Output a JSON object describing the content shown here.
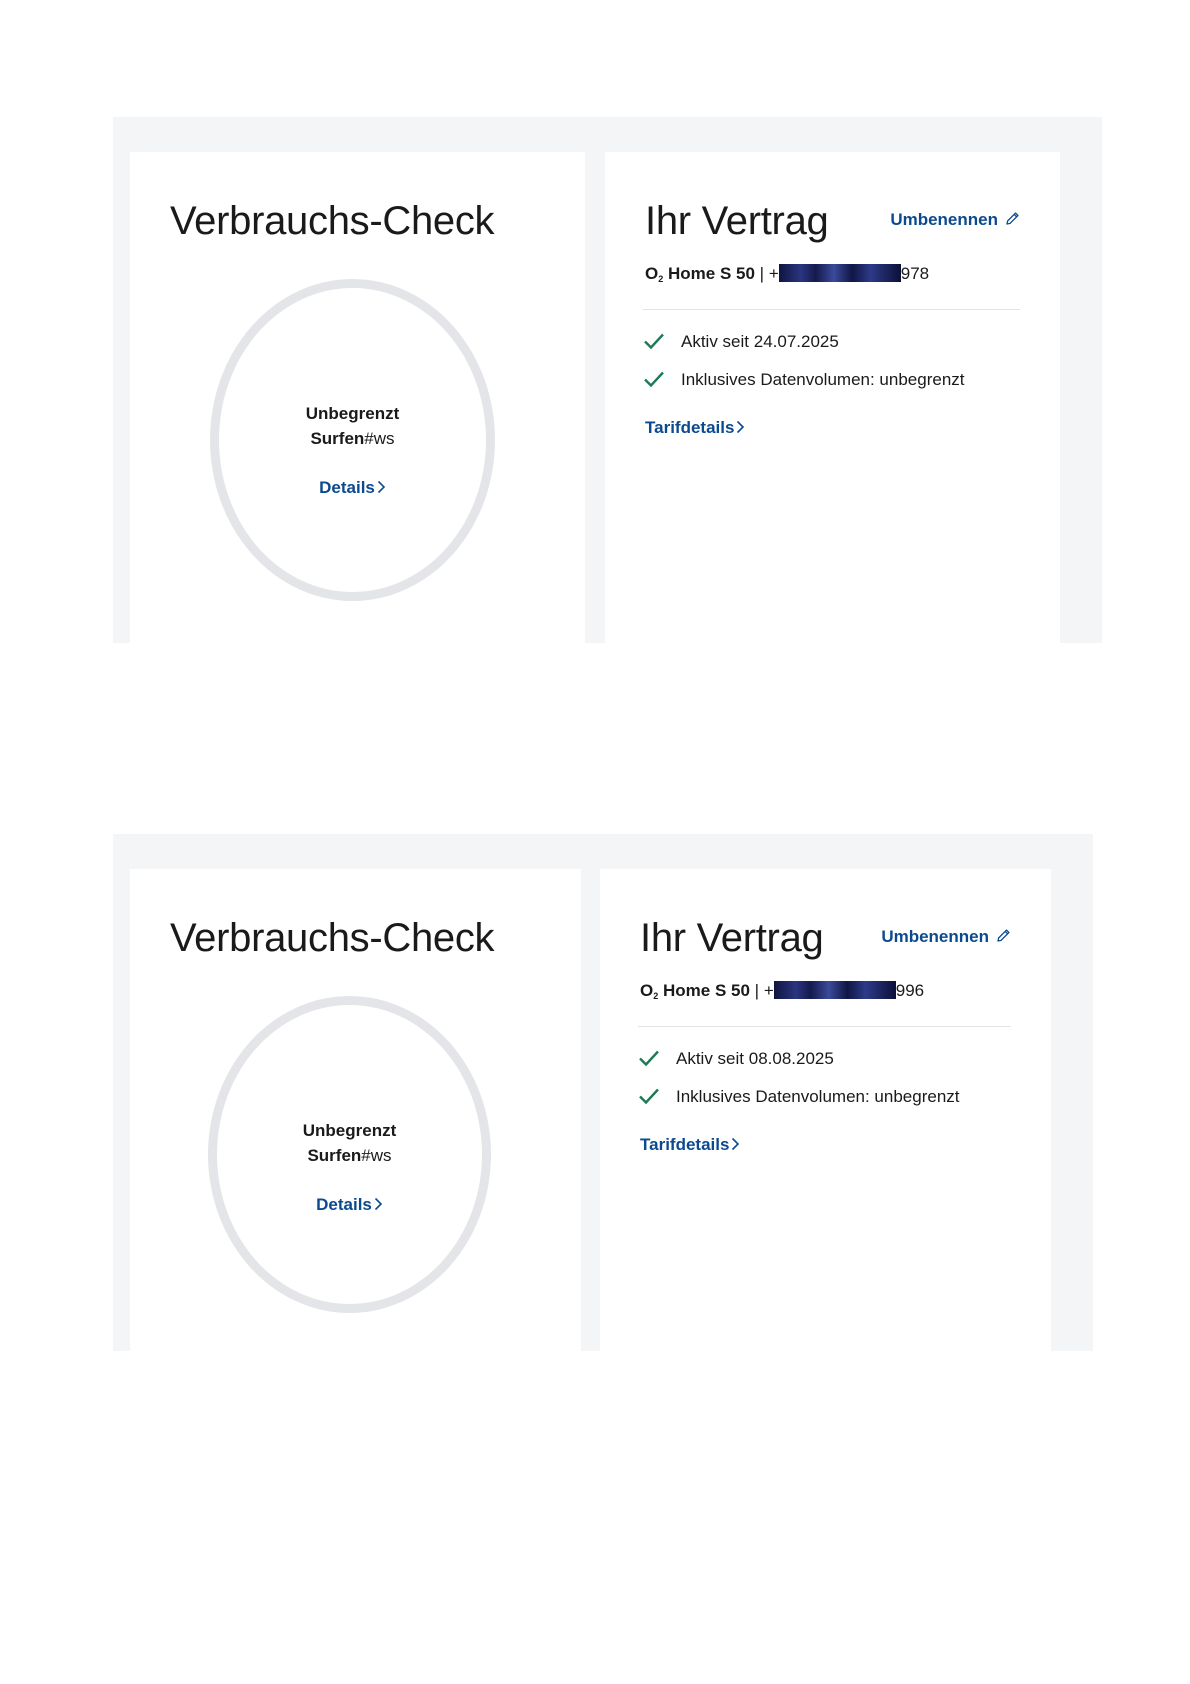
{
  "colors": {
    "link": "#0c4a8f",
    "check": "#1d7a55",
    "ring": "#e4e5e9",
    "frame": "#f4f5f7"
  },
  "screenshots": [
    {
      "usage_check": {
        "title": "Verbrauchs-Check",
        "ring_line1": "Unbegrenzt",
        "ring_line2_main": "Surfen",
        "ring_line2_suffix": "#ws",
        "details_label": "Details",
        "details_icon": "chevron-right-icon"
      },
      "contract": {
        "title": "Ihr Vertrag",
        "rename_label": "Umbenennen",
        "rename_icon": "pencil-icon",
        "plan_o": "O",
        "plan_sub": "2",
        "plan_name": "Home S 50",
        "separator": "|",
        "phone_prefix": "+",
        "phone_suffix": "978",
        "features": [
          {
            "icon": "checkmark-icon",
            "text": "Aktiv seit 24.07.2025"
          },
          {
            "icon": "checkmark-icon",
            "text": "Inklusives Datenvolumen: unbegrenzt"
          }
        ],
        "tarif_label": "Tarifdetails",
        "tarif_icon": "chevron-right-icon"
      }
    },
    {
      "usage_check": {
        "title": "Verbrauchs-Check",
        "ring_line1": "Unbegrenzt",
        "ring_line2_main": "Surfen",
        "ring_line2_suffix": "#ws",
        "details_label": "Details",
        "details_icon": "chevron-right-icon"
      },
      "contract": {
        "title": "Ihr Vertrag",
        "rename_label": "Umbenennen",
        "rename_icon": "pencil-icon",
        "plan_o": "O",
        "plan_sub": "2",
        "plan_name": "Home S 50",
        "separator": "|",
        "phone_prefix": "+",
        "phone_suffix": "996",
        "features": [
          {
            "icon": "checkmark-icon",
            "text": "Aktiv seit 08.08.2025"
          },
          {
            "icon": "checkmark-icon",
            "text": "Inklusives Datenvolumen: unbegrenzt"
          }
        ],
        "tarif_label": "Tarifdetails",
        "tarif_icon": "chevron-right-icon"
      }
    }
  ]
}
